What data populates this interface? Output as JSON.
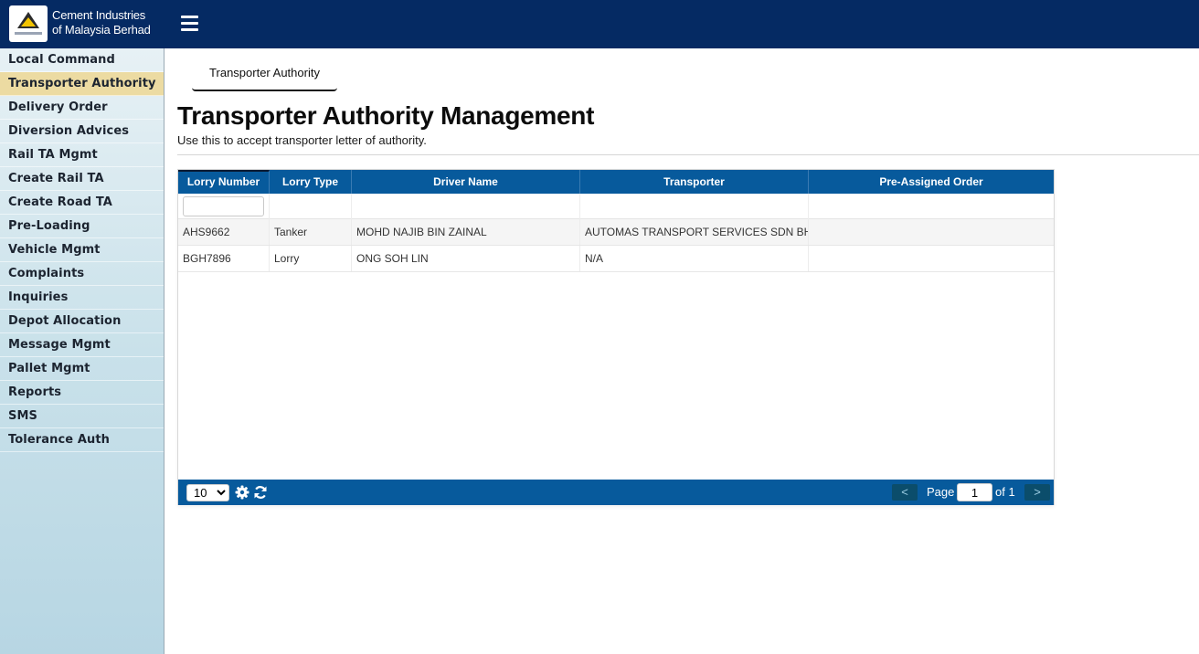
{
  "header": {
    "brand_line1": "Cement Industries",
    "brand_line2": "of Malaysia Berhad",
    "menu_icon": "hamburger-icon"
  },
  "sidebar": {
    "items": [
      {
        "label": "Local Command",
        "active": false
      },
      {
        "label": "Transporter Authority",
        "active": true
      },
      {
        "label": "Delivery Order",
        "active": false
      },
      {
        "label": "Diversion Advices",
        "active": false
      },
      {
        "label": "Rail TA Mgmt",
        "active": false
      },
      {
        "label": "Create Rail TA",
        "active": false
      },
      {
        "label": "Create Road TA",
        "active": false
      },
      {
        "label": "Pre-Loading",
        "active": false
      },
      {
        "label": "Vehicle Mgmt",
        "active": false
      },
      {
        "label": "Complaints",
        "active": false
      },
      {
        "label": "Inquiries",
        "active": false
      },
      {
        "label": "Depot Allocation",
        "active": false
      },
      {
        "label": "Message Mgmt",
        "active": false
      },
      {
        "label": "Pallet Mgmt",
        "active": false
      },
      {
        "label": "Reports",
        "active": false
      },
      {
        "label": "SMS",
        "active": false
      },
      {
        "label": "Tolerance Auth",
        "active": false
      }
    ]
  },
  "main": {
    "tab_label": "Transporter Authority",
    "title": "Transporter Authority Management",
    "subtitle": "Use this to accept transporter letter of authority."
  },
  "grid": {
    "columns": [
      "Lorry Number",
      "Lorry Type",
      "Driver Name",
      "Transporter",
      "Pre-Assigned Order"
    ],
    "filter_value": "",
    "rows": [
      [
        "AHS9662",
        "Tanker",
        "MOHD NAJIB BIN ZAINAL",
        "AUTOMAS TRANSPORT SERVICES SDN BHD",
        ""
      ],
      [
        "BGH7896",
        "Lorry",
        "ONG SOH LIN",
        "N/A",
        ""
      ]
    ],
    "footer": {
      "page_size": "10",
      "page_size_options": [
        "10"
      ],
      "settings_icon": "gear-icon",
      "refresh_icon": "refresh-icon",
      "prev_label": "<",
      "page_label": "Page",
      "page_value": "1",
      "of_label": "of 1",
      "next_label": ">"
    }
  },
  "colors": {
    "topbar": "#052a63",
    "grid_header": "#075a9c",
    "active_sidebar": "#ecdba2"
  }
}
